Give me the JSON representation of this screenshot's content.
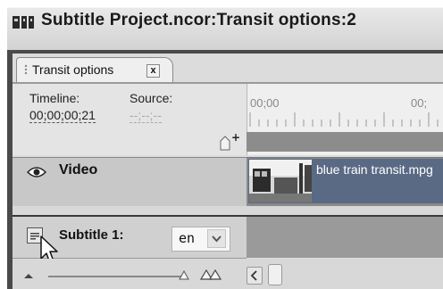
{
  "window": {
    "title": "Subtitle Project.ncor:Transit options:2"
  },
  "tab": {
    "label": "Transit options",
    "close": "x"
  },
  "timeline": {
    "timeline_label": "Timeline:",
    "timeline_value": "00;00;00;21",
    "source_label": "Source:",
    "source_value": "--;--;--",
    "ruler_start": "00;00",
    "ruler_end": "00;"
  },
  "tracks": {
    "video_label": "Video",
    "clip_label": "blue train transit.mpg",
    "subtitle_label": "Subtitle 1:",
    "language": "en"
  },
  "colors": {
    "panel_dark": "#4a4a4a",
    "clip_fill": "#5a6a84",
    "ruler_track": "#8c8c8c"
  },
  "icons": [
    "app-icon",
    "grip-icon",
    "close-icon",
    "add-marker-icon",
    "eye-icon",
    "subtitle-track-icon",
    "chevron-down-icon",
    "mouse-pointer-icon",
    "zoom-out-icon",
    "zoom-in-icon",
    "scroll-left-icon"
  ]
}
